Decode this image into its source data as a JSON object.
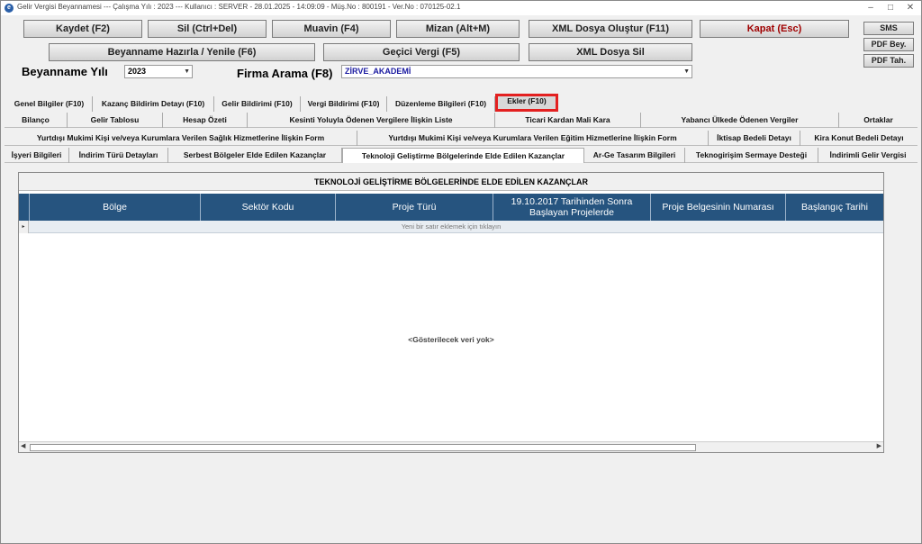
{
  "window": {
    "title": "Gelir Vergisi Beyannamesi  ---  Çalışma Yılı : 2023  ---  Kullanıcı : SERVER - 28.01.2025 - 14:09:09 - Müş.No : 800191 - Ver.No : 070125-02.1",
    "icon_letter": "e"
  },
  "toolbar": {
    "kaydet": "Kaydet (F2)",
    "sil": "Sil (Ctrl+Del)",
    "muavin": "Muavin (F4)",
    "mizan": "Mizan (Alt+M)",
    "xml_olustur": "XML Dosya Oluştur (F11)",
    "kapat": "Kapat (Esc)",
    "beyanname_hazirla": "Beyanname Hazırla / Yenile (F6)",
    "gecici_vergi": "Geçici Vergi (F5)",
    "xml_sil": "XML Dosya Sil",
    "sms": "SMS",
    "pdf_bey": "PDF Bey.",
    "pdf_tah": "PDF Tah."
  },
  "filters": {
    "year_label": "Beyanname Yılı",
    "year_value": "2023",
    "firm_label": "Firma Arama (F8)",
    "firm_value": "ZİRVE_AKADEMİ"
  },
  "main_tabs": [
    "Genel Bilgiler (F10)",
    "Kazanç Bildirim Detayı (F10)",
    "Gelir Bildirimi (F10)",
    "Vergi Bildirimi (F10)",
    "Düzenleme Bilgileri (F10)",
    "Ekler (F10)"
  ],
  "sub_tabs_row1": [
    "Bilanço",
    "Gelir Tablosu",
    "Hesap Özeti",
    "Kesinti Yoluyla Ödenen Vergilere İlişkin Liste",
    "Ticari Kardan Mali Kara",
    "Yabancı Ülkede Ödenen Vergiler",
    "Ortaklar"
  ],
  "sub_tabs_row2": [
    "Yurtdışı Mukimi Kişi ve/veya Kurumlara Verilen Sağlık Hizmetlerine İlişkin Form",
    "Yurtdışı Mukimi Kişi ve/veya Kurumlara Verilen Eğitim Hizmetlerine İlişkin Form",
    "İktisap Bedeli Detayı",
    "Kira Konut Bedeli Detayı"
  ],
  "sub_tabs_row3": [
    "İşyeri Bilgileri",
    "İndirim Türü Detayları",
    "Serbest Bölgeler Elde Edilen Kazançlar",
    "Teknoloji Geliştirme Bölgelerinde Elde Edilen Kazançlar",
    "Ar-Ge Tasarım Bilgileri",
    "Teknogirişim Sermaye Desteği",
    "İndirimli Gelir Vergisi"
  ],
  "panel": {
    "title": "TEKNOLOJİ GELİŞTİRME BÖLGELERİNDE ELDE EDİLEN KAZANÇLAR",
    "columns": [
      "Bölge",
      "Sektör Kodu",
      "Proje Türü",
      "19.10.2017 Tarihinden Sonra Başlayan Projelerde",
      "Proje Belgesinin Numarası",
      "Başlangıç Tarihi"
    ],
    "new_row_text": "Yeni bir satır eklemek için tıklayın",
    "empty_text": "<Gösterilecek veri yok>"
  }
}
